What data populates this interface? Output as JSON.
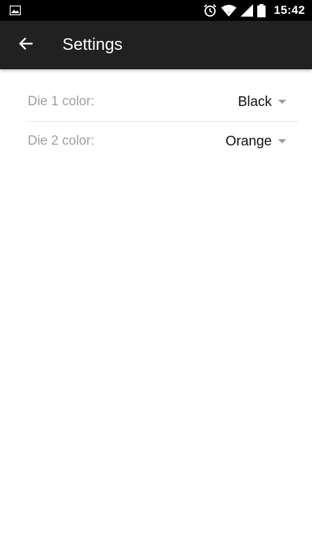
{
  "status_bar": {
    "time": "15:42",
    "icons": [
      "image-icon",
      "alarm-icon",
      "wifi-icon",
      "signal-icon",
      "battery-icon"
    ]
  },
  "app_bar": {
    "title": "Settings",
    "back_icon": "arrow-left-icon",
    "background": "#212121"
  },
  "settings": [
    {
      "label": "Die 1 color:",
      "value": "Black"
    },
    {
      "label": "Die 2 color:",
      "value": "Orange"
    }
  ]
}
